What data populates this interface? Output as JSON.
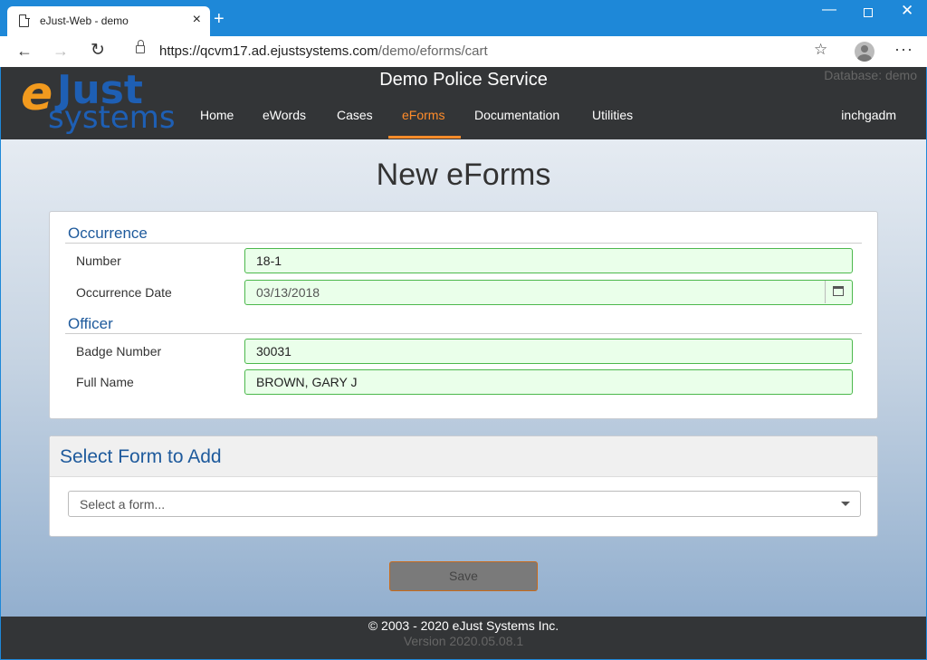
{
  "browser": {
    "tab_title": "eJust-Web - demo",
    "tab_close": "×",
    "new_tab": "+",
    "url_host": "https://qcvm17.ad.ejustsystems.com",
    "url_path": "/demo/eforms/cart",
    "window_min": "—",
    "window_close": "✕",
    "more": "···"
  },
  "logo": {
    "e": "e",
    "just": "Just",
    "systems": "systems"
  },
  "header": {
    "site_title": "Demo Police Service",
    "database": "Database: demo",
    "user": "inchgadm",
    "nav": [
      "Home",
      "eWords",
      "Cases",
      "eForms",
      "Documentation",
      "Utilities"
    ],
    "active_nav": "eForms",
    "accent_color": "#ff8c2a"
  },
  "page": {
    "title": "New eForms"
  },
  "occurrence": {
    "section_title": "Occurrence",
    "number_label": "Number",
    "number_value": "18-1",
    "date_label": "Occurrence Date",
    "date_value": "03/13/2018"
  },
  "officer": {
    "section_title": "Officer",
    "badge_label": "Badge Number",
    "badge_value": "30031",
    "name_label": "Full Name",
    "name_value": "BROWN, GARY J"
  },
  "form_select": {
    "title": "Select Form to Add",
    "placeholder": "Select a form..."
  },
  "save_label": "Save",
  "footer": {
    "copyright": "© 2003 - 2020 eJust Systems Inc.",
    "version": "Version 2020.05.08.1"
  }
}
